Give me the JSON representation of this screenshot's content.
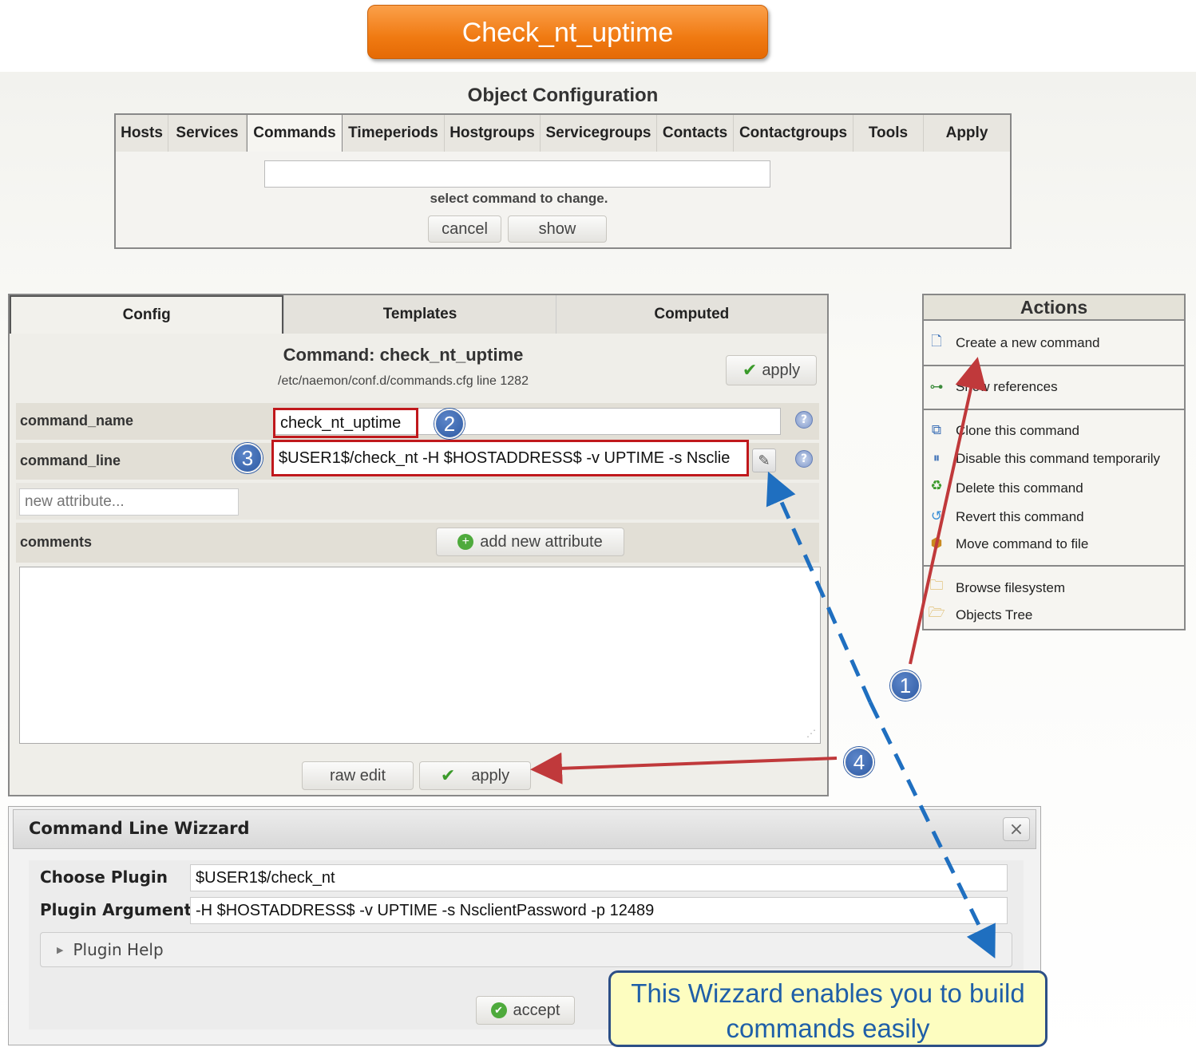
{
  "banner": {
    "title": "Check_nt_uptime"
  },
  "object_config": {
    "title": "Object Configuration",
    "tabs": [
      {
        "label": "Hosts"
      },
      {
        "label": "Services"
      },
      {
        "label": "Commands"
      },
      {
        "label": "Timeperiods"
      },
      {
        "label": "Hostgroups"
      },
      {
        "label": "Servicegroups"
      },
      {
        "label": "Contacts"
      },
      {
        "label": "Contactgroups"
      },
      {
        "label": "Tools"
      },
      {
        "label": "Apply"
      }
    ],
    "active_tab": "Commands",
    "select_value": "",
    "select_label": "select command to change.",
    "cancel_label": "cancel",
    "show_label": "show"
  },
  "panel": {
    "tabs": [
      {
        "label": "Config"
      },
      {
        "label": "Templates"
      },
      {
        "label": "Computed"
      }
    ],
    "title": "Command: check_nt_uptime",
    "path": "/etc/naemon/conf.d/commands.cfg line 1282",
    "apply_label": "apply",
    "command_name": {
      "label": "command_name",
      "value": "check_nt_uptime"
    },
    "command_line": {
      "label": "command_line",
      "value": "$USER1$/check_nt -H $HOSTADDRESS$ -v UPTIME -s Nsclie"
    },
    "new_attribute_placeholder": "new attribute...",
    "add_attribute_label": "add new attribute",
    "comments_label": "comments",
    "comments_value": "",
    "raw_edit_label": "raw edit",
    "bottom_apply_label": "apply"
  },
  "actions": {
    "title": "Actions",
    "groups": [
      [
        {
          "label": "Create a new command",
          "icon": "new-document-icon"
        }
      ],
      [
        {
          "label": "Show references",
          "icon": "sitemap-icon"
        }
      ],
      [
        {
          "label": "Clone this command",
          "icon": "copy-icon"
        },
        {
          "label": "Disable this command temporarily",
          "icon": "pause-icon"
        },
        {
          "label": "Delete this command",
          "icon": "recycle-icon"
        },
        {
          "label": "Revert this command",
          "icon": "revert-icon"
        },
        {
          "label": "Move command to file",
          "icon": "box-icon"
        }
      ],
      [
        {
          "label": "Browse filesystem",
          "icon": "folder-search-icon"
        },
        {
          "label": "Objects Tree",
          "icon": "folder-icon"
        }
      ]
    ]
  },
  "wizard": {
    "title": "Command Line Wizzard",
    "close_symbol": "×",
    "plugin_label": "Choose Plugin",
    "plugin_value": "$USER1$/check_nt",
    "args_label": "Plugin Arguments",
    "args_value": "-H $HOSTADDRESS$ -v UPTIME -s NsclientPassword -p 12489",
    "help_label": "Plugin Help",
    "accept_label": "accept"
  },
  "annotations": {
    "steps": [
      "1",
      "2",
      "3",
      "4"
    ],
    "callout": "This Wizzard enables you to build commands easily"
  },
  "colors": {
    "banner": "#f07a12",
    "highlight": "#c0181c",
    "badge": "#2d5aa3",
    "arrow_red": "#c0393b",
    "arrow_blue": "#1f6fc0",
    "callout_bg": "#fdfdc0"
  }
}
